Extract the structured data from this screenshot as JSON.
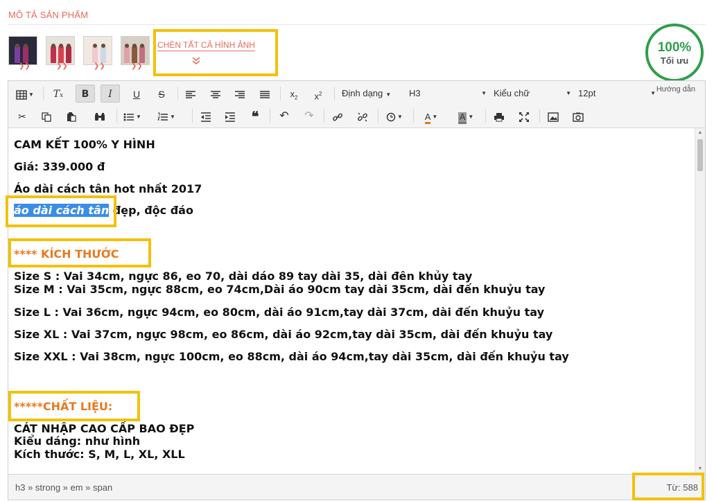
{
  "section": {
    "title": "MÔ TẢ SẢN PHẨM"
  },
  "thumbnails": [
    {
      "name": "product-thumbnail-1"
    },
    {
      "name": "product-thumbnail-2"
    },
    {
      "name": "product-thumbnail-3"
    },
    {
      "name": "product-thumbnail-4"
    }
  ],
  "insert_all_label": "CHÈN TẤT CẢ HÌNH ẢNH",
  "score": {
    "value": "100%",
    "label": "Tối ưu"
  },
  "toolbar": {
    "guide_label": "Hướng dẫn",
    "format_label": "Định dạng",
    "heading_value": "H3",
    "font_label": "Kiểu chữ",
    "size_value": "12pt",
    "row1_icons": [
      "table-icon",
      "clear-format-icon",
      "bold-icon",
      "italic-icon",
      "underline-icon",
      "strikethrough-icon",
      "align-left-icon",
      "align-center-icon",
      "align-right-icon",
      "align-justify-icon",
      "subscript-icon",
      "superscript-icon"
    ],
    "row2_icons": [
      "cut-icon",
      "copy-icon",
      "paste-icon",
      "find-icon",
      "bullet-list-icon",
      "numbered-list-icon",
      "outdent-icon",
      "indent-icon",
      "blockquote-icon",
      "undo-icon",
      "redo-icon",
      "link-icon",
      "unlink-icon",
      "timestamp-icon",
      "text-color-icon",
      "background-color-icon",
      "print-icon",
      "fullscreen-icon",
      "image-icon",
      "media-icon"
    ]
  },
  "content": {
    "commit": "CAM KẾT 100% Y HÌNH",
    "price": "Giá: 339.000 đ",
    "headline": "Áo dài cách tân hot nhất 2017",
    "selected_text": "áo dài cách tân",
    "line4_rest": " đẹp, độc đáo",
    "size_heading": "**** KÍCH THƯỚC",
    "sizes": [
      "Size S : Vai 34cm, ngực 86, eo 70, dài dáo 89 tay dài 35, dài đên khủy tay",
      "Size M :  Vai 35cm, ngực 88cm, eo 74cm,Dài áo 90cm tay dài 35cm, dài đến khuỷu tay",
      "Size L :  Vai 36cm, ngực 94cm, eo 80cm, dài áo 91cm,tay dài 37cm, dài đến khuỷu tay",
      "Size XL :  Vai 37cm, ngực 98cm, eo 86cm, dài áo 92cm,tay dài 35cm, dài đến khuỷu tay",
      "Size XXL :  Vai 38cm, ngực 100cm, eo 88cm, dài áo 94cm,tay dài 35cm, dài đến khuỷu tay"
    ],
    "material_heading": "*****CHẤT LIỆU:",
    "material": "CÁT NHẬP CAO CẤP BAO ĐẸP",
    "style": "Kiểu dáng: như hình",
    "size_list": "Kích thước: S, M, L, XL, XLL"
  },
  "status": {
    "path": "h3 » strong » em » span",
    "word_count": "Từ: 588"
  },
  "colors": {
    "accent": "#e8695a",
    "highlight": "#f2c10d",
    "score_green": "#2e9e49",
    "heading_orange": "#e8791e",
    "selection": "#3a8ee6"
  }
}
